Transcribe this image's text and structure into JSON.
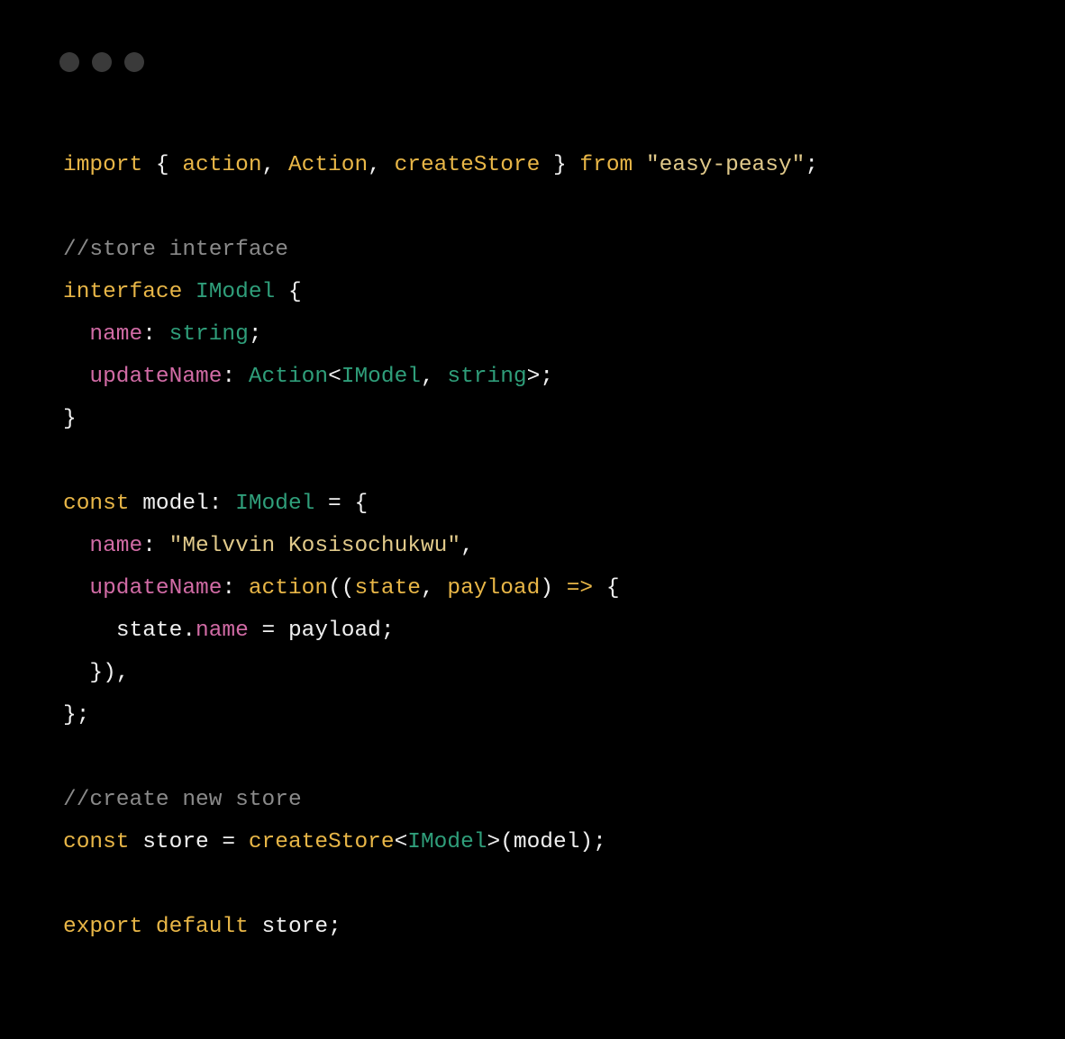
{
  "window": {
    "dots": 3
  },
  "code": {
    "l1": {
      "kw1": "import",
      "brace1": " { ",
      "i1": "action",
      "c1": ", ",
      "i2": "Action",
      "c2": ", ",
      "i3": "createStore",
      "brace2": " } ",
      "kw2": "from",
      "sp": " ",
      "str": "\"easy-peasy\"",
      "semi": ";"
    },
    "l2": "",
    "l3": {
      "comment": "//store interface"
    },
    "l4": {
      "kw": "interface",
      "sp": " ",
      "tp": "IModel",
      "brace": " {"
    },
    "l5": {
      "indent": "  ",
      "pk": "name",
      "colon": ": ",
      "tp": "string",
      "semi": ";"
    },
    "l6": {
      "indent": "  ",
      "pk": "updateName",
      "colon": ": ",
      "tp1": "Action",
      "lt": "<",
      "tp2": "IModel",
      "c": ", ",
      "tp3": "string",
      "gt": ">",
      "semi": ";"
    },
    "l7": {
      "brace": "}"
    },
    "l8": "",
    "l9": {
      "kw": "const",
      "sp": " ",
      "id": "model",
      "colon": ": ",
      "tp": "IModel",
      "eq": " = {"
    },
    "l10": {
      "indent": "  ",
      "pk": "name",
      "colon": ": ",
      "str": "\"Melvvin Kosisochukwu\"",
      "c": ","
    },
    "l11": {
      "indent": "  ",
      "pk": "updateName",
      "colon": ": ",
      "fn": "action",
      "p1": "((",
      "a1": "state",
      "c": ", ",
      "a2": "payload",
      "p2": ") ",
      "arrow": "=>",
      "brace": " {"
    },
    "l12": {
      "indent": "    ",
      "id1": "state",
      "dot": ".",
      "pk": "name",
      "eq": " = ",
      "id2": "payload",
      "semi": ";"
    },
    "l13": {
      "indent": "  ",
      "close": "}),"
    },
    "l14": {
      "close": "};"
    },
    "l15": "",
    "l16": {
      "comment": "//create new store"
    },
    "l17": {
      "kw": "const",
      "sp": " ",
      "id": "store",
      "eq": " = ",
      "fn": "createStore",
      "lt": "<",
      "tp": "IModel",
      "gt": ">",
      "p1": "(",
      "arg": "model",
      "p2": ")",
      "semi": ";"
    },
    "l18": "",
    "l19": {
      "kw1": "export",
      "sp1": " ",
      "kw2": "default",
      "sp2": " ",
      "id": "store",
      "semi": ";"
    }
  }
}
